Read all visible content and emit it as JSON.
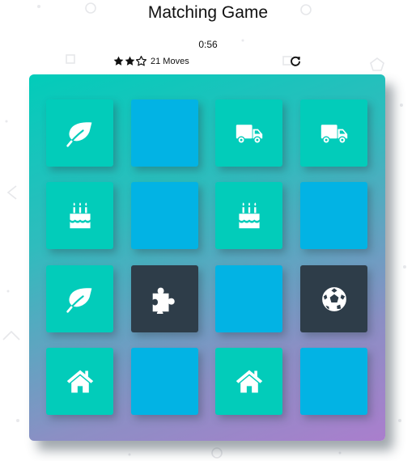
{
  "header": {
    "title": "Matching Game",
    "timer": "0:56",
    "moves": "21 Moves",
    "stars_filled": 2,
    "stars_total": 3
  },
  "colors": {
    "closed": "#02b3e4",
    "match": "#02ccba",
    "open": "#2e3d49",
    "gradient_start": "#02ccba",
    "gradient_end": "#aa7ecd"
  },
  "deck": {
    "cards": [
      {
        "state": "match",
        "icon": "leaf-icon"
      },
      {
        "state": "closed",
        "icon": ""
      },
      {
        "state": "match",
        "icon": "truck-icon"
      },
      {
        "state": "match",
        "icon": "truck-icon"
      },
      {
        "state": "match",
        "icon": "birthday-cake-icon"
      },
      {
        "state": "closed",
        "icon": ""
      },
      {
        "state": "match",
        "icon": "birthday-cake-icon"
      },
      {
        "state": "closed",
        "icon": ""
      },
      {
        "state": "match",
        "icon": "leaf-icon"
      },
      {
        "state": "open",
        "icon": "puzzle-piece-icon"
      },
      {
        "state": "closed",
        "icon": ""
      },
      {
        "state": "open",
        "icon": "soccer-ball-icon"
      },
      {
        "state": "match",
        "icon": "home-icon"
      },
      {
        "state": "closed",
        "icon": ""
      },
      {
        "state": "match",
        "icon": "home-icon"
      },
      {
        "state": "closed",
        "icon": ""
      }
    ]
  }
}
